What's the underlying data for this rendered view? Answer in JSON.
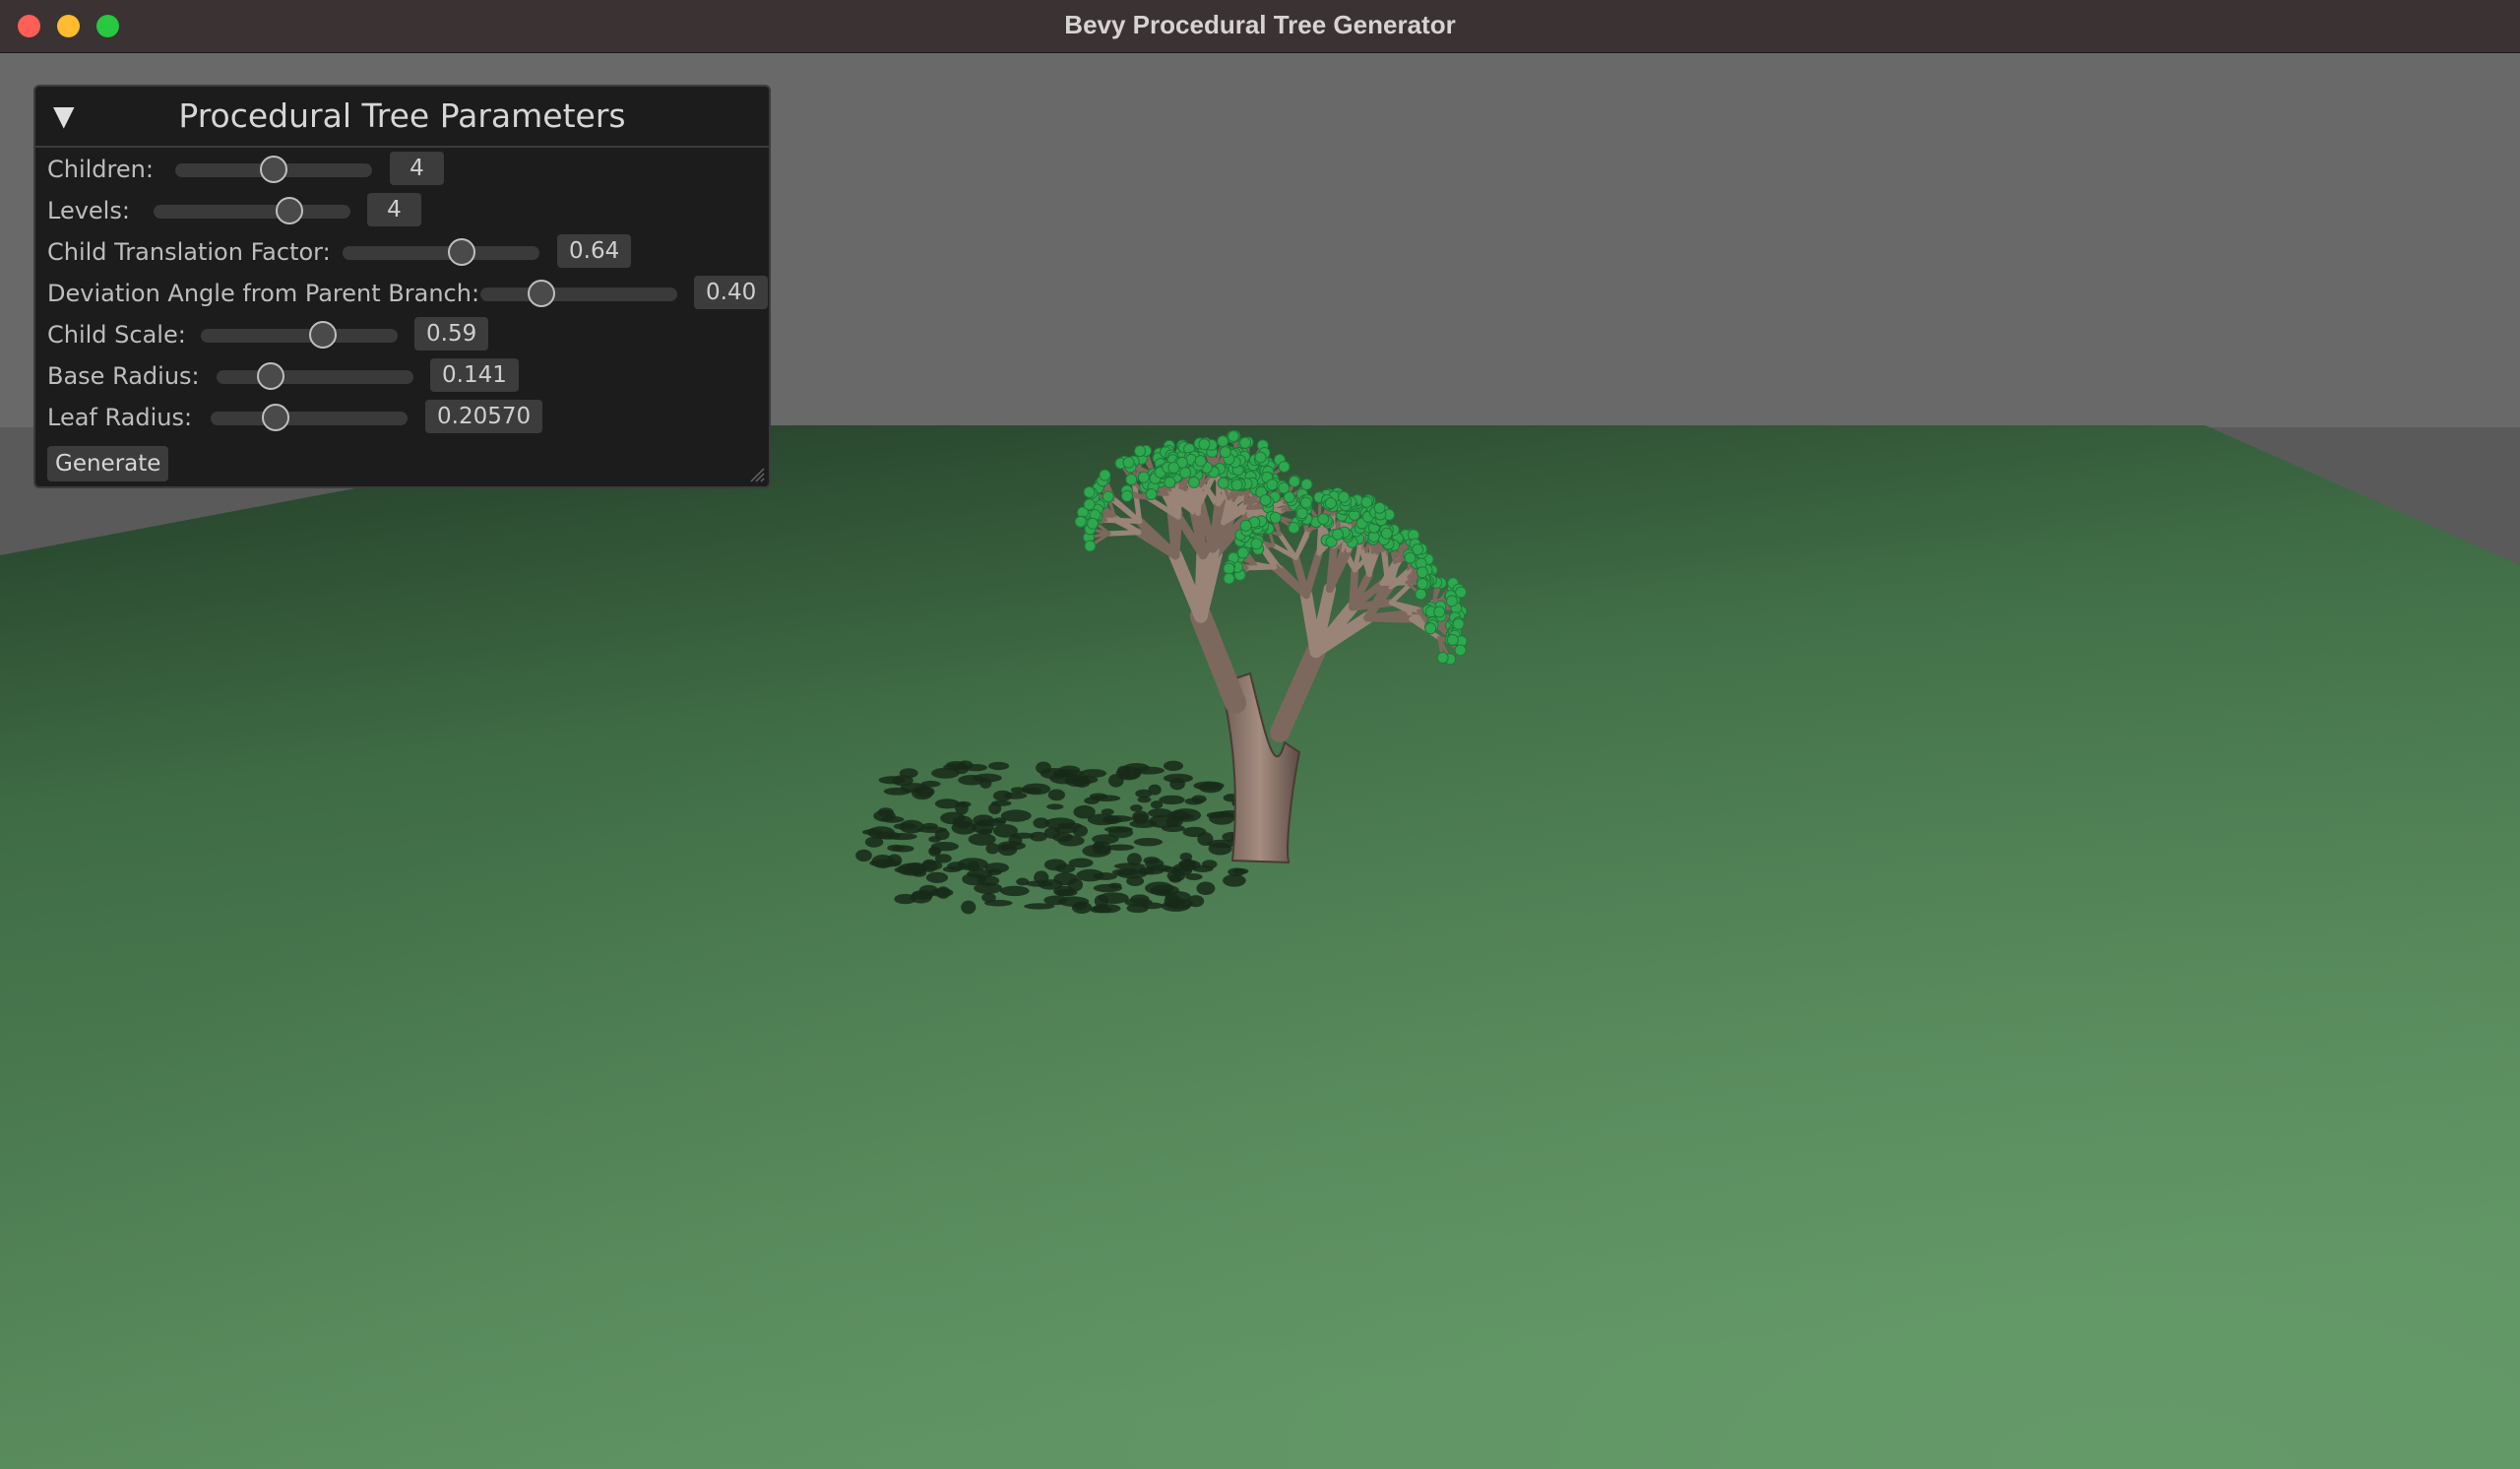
{
  "window": {
    "title": "Bevy Procedural Tree Generator",
    "controls": [
      "close",
      "minimize",
      "maximize"
    ]
  },
  "colors": {
    "sky": "#696969",
    "ground_near": "#5c8f60",
    "ground_far": "#2b4a30",
    "bark": "#8a7468",
    "leaf": "#2ea84f",
    "panel_bg": "#1c1c1c",
    "accent_close": "#ff5f57",
    "accent_min": "#febc2e",
    "accent_max": "#28c840"
  },
  "panel": {
    "title": "Procedural Tree Parameters",
    "collapse_icon": "triangle-down-icon",
    "params": [
      {
        "label": "Children:",
        "value": "4",
        "fraction": 0.5
      },
      {
        "label": "Levels:",
        "value": "4",
        "fraction": 0.72
      },
      {
        "label": "Child Translation Factor:",
        "value": "0.64",
        "fraction": 0.62
      },
      {
        "label": "Deviation Angle from Parent Branch:",
        "value": "0.40",
        "fraction": 0.28
      },
      {
        "label": "Child Scale:",
        "value": "0.59",
        "fraction": 0.64
      },
      {
        "label": "Base Radius:",
        "value": "0.141",
        "fraction": 0.24
      },
      {
        "label": "Leaf Radius:",
        "value": "0.20570",
        "fraction": 0.3
      }
    ],
    "generate_label": "Generate"
  }
}
